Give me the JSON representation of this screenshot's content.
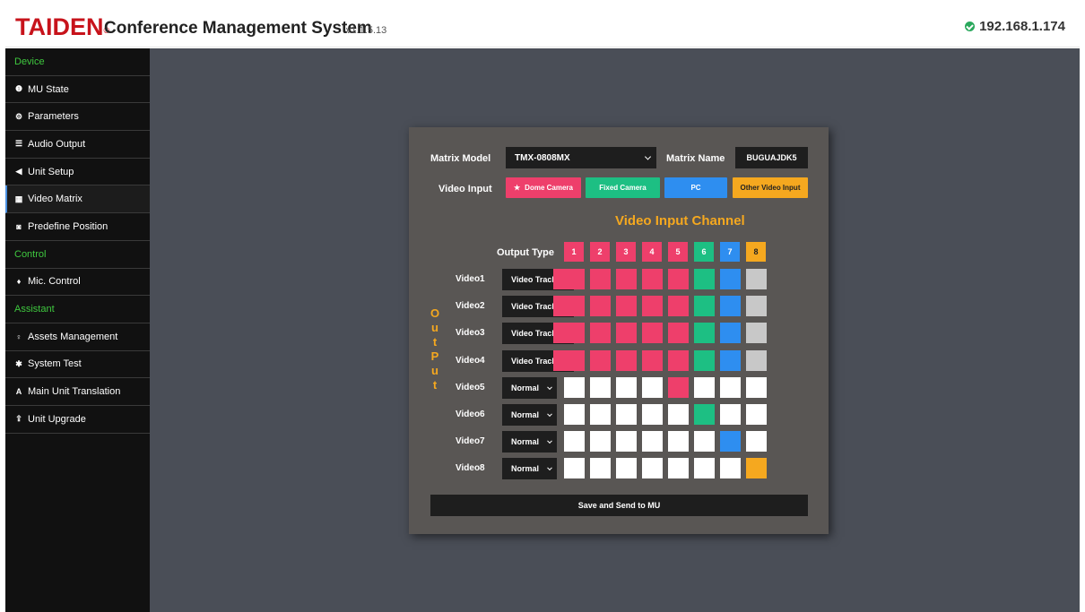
{
  "header": {
    "brand": "TAIDEN",
    "brand_mark": "®",
    "title": "Conference Management System",
    "version": "v1.1.5.13",
    "ip": "192.168.1.174"
  },
  "sidebar": {
    "items": [
      {
        "label": "Device",
        "type": "section"
      },
      {
        "label": "MU State",
        "icon": "info-icon"
      },
      {
        "label": "Parameters",
        "icon": "gears-icon"
      },
      {
        "label": "Audio Output",
        "icon": "sliders-icon"
      },
      {
        "label": "Unit Setup",
        "icon": "speaker-icon"
      },
      {
        "label": "Video Matrix",
        "icon": "grid-icon",
        "active": true
      },
      {
        "label": "Predefine Position",
        "icon": "camera-icon"
      },
      {
        "label": "Control",
        "type": "section"
      },
      {
        "label": "Mic. Control",
        "icon": "mic-icon"
      },
      {
        "label": "Assistant",
        "type": "section"
      },
      {
        "label": "Assets Management",
        "icon": "lightbulb-icon"
      },
      {
        "label": "System Test",
        "icon": "bug-icon"
      },
      {
        "label": "Main Unit Translation",
        "icon": "letter-a-icon"
      },
      {
        "label": "Unit Upgrade",
        "icon": "upload-icon"
      }
    ]
  },
  "matrix": {
    "model_label": "Matrix Model",
    "model_value": "TMX-0808MX",
    "name_label": "Matrix Name",
    "name_value": "BUGUAJDK5",
    "video_input_label": "Video Input",
    "input_types": [
      {
        "label": "Dome Camera",
        "color": "#ee3f6b",
        "star": "★"
      },
      {
        "label": "Fixed Camera",
        "color": "#1dbf83"
      },
      {
        "label": "PC",
        "color": "#2e8ef0"
      },
      {
        "label": "Other Video Input",
        "color": "#f5a81f"
      }
    ],
    "channel_title": "Video Input Channel",
    "output_vertical": [
      "O",
      "u",
      "t",
      "P",
      "u",
      "t"
    ],
    "output_type_label": "Output Type",
    "channels": [
      {
        "num": "1",
        "color": "#ee3f6b"
      },
      {
        "num": "2",
        "color": "#ee3f6b"
      },
      {
        "num": "3",
        "color": "#ee3f6b"
      },
      {
        "num": "4",
        "color": "#ee3f6b"
      },
      {
        "num": "5",
        "color": "#ee3f6b"
      },
      {
        "num": "6",
        "color": "#1dbf83"
      },
      {
        "num": "7",
        "color": "#2e8ef0"
      },
      {
        "num": "8",
        "color": "#f5a81f"
      }
    ],
    "rows": [
      {
        "label": "Video1",
        "type": "Video Track",
        "cells": [
          "pink",
          "pink",
          "pink",
          "pink",
          "pink",
          "green",
          "blue",
          "gray"
        ]
      },
      {
        "label": "Video2",
        "type": "Video Track",
        "cells": [
          "pink",
          "pink",
          "pink",
          "pink",
          "pink",
          "green",
          "blue",
          "gray"
        ]
      },
      {
        "label": "Video3",
        "type": "Video Track",
        "cells": [
          "pink",
          "pink",
          "pink",
          "pink",
          "pink",
          "green",
          "blue",
          "gray"
        ]
      },
      {
        "label": "Video4",
        "type": "Video Track",
        "cells": [
          "pink",
          "pink",
          "pink",
          "pink",
          "pink",
          "green",
          "blue",
          "gray"
        ]
      },
      {
        "label": "Video5",
        "type": "Normal",
        "cells": [
          "white",
          "white",
          "white",
          "white",
          "pink",
          "white",
          "white",
          "white"
        ]
      },
      {
        "label": "Video6",
        "type": "Normal",
        "cells": [
          "white",
          "white",
          "white",
          "white",
          "white",
          "green",
          "white",
          "white"
        ]
      },
      {
        "label": "Video7",
        "type": "Normal",
        "cells": [
          "white",
          "white",
          "white",
          "white",
          "white",
          "white",
          "blue",
          "white"
        ]
      },
      {
        "label": "Video8",
        "type": "Normal",
        "cells": [
          "white",
          "white",
          "white",
          "white",
          "white",
          "white",
          "white",
          "orange"
        ]
      }
    ],
    "cell_colors": {
      "pink": "#ee3f6b",
      "green": "#1dbf83",
      "blue": "#2e8ef0",
      "orange": "#f5a81f",
      "gray": "#c8c8c8",
      "white": "#ffffff"
    },
    "save_label": "Save and Send to MU"
  }
}
